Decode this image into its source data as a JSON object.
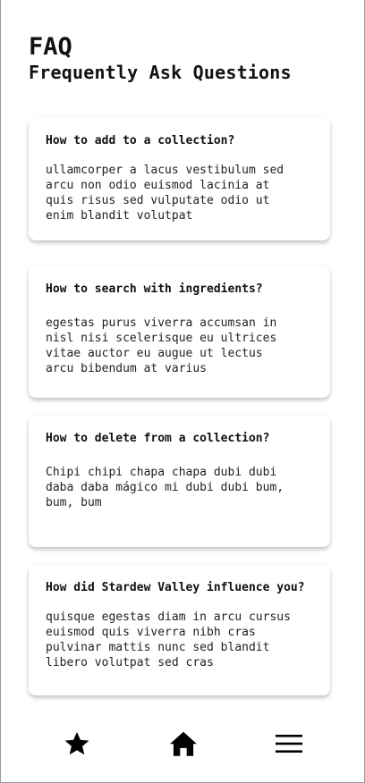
{
  "header": {
    "title": "FAQ",
    "subtitle": "Frequently Ask Questions"
  },
  "faq": [
    {
      "question": "How to add to a collection?",
      "answer_lines": [
        "ullamcorper a lacus vestibulum sed",
        "arcu non odio euismod lacinia at",
        "quis risus sed vulputate odio ut",
        "enim blandit volutpat"
      ]
    },
    {
      "question": "How to search with ingredients?",
      "answer_lines": [
        "egestas purus viverra accumsan in",
        "nisl nisi scelerisque eu ultrices",
        "vitae auctor eu augue ut lectus",
        "arcu bibendum at varius"
      ]
    },
    {
      "question": "How to delete from a collection?",
      "answer_lines": [
        "Chipi chipi chapa chapa dubi dubi",
        "daba daba mágico mi dubi dubi bum,",
        "bum, bum"
      ]
    },
    {
      "question": "How did Stardew Valley influence you?",
      "answer_lines": [
        "quisque egestas diam in arcu cursus",
        "euismod quis viverra nibh cras",
        "pulvinar mattis nunc sed blandit",
        "libero volutpat sed cras"
      ]
    }
  ],
  "bottom_nav": {
    "items": [
      {
        "icon": "star-icon"
      },
      {
        "icon": "home-icon"
      },
      {
        "icon": "menu-icon"
      }
    ]
  },
  "colors": {
    "background": "#ffffff",
    "text": "#111111",
    "icon": "#000000"
  }
}
